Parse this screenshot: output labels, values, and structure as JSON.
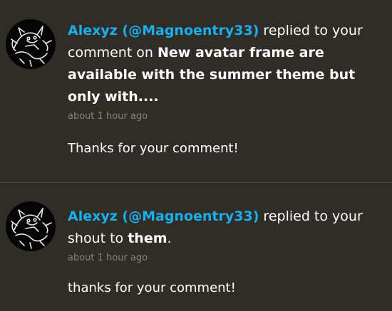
{
  "notifications": [
    {
      "author": "Alexyz (@Magnoentry33)",
      "action": " replied to your comment on ",
      "target": "New avatar frame are available with the summer theme but only with....",
      "suffix": "",
      "time": "about 1 hour ago",
      "message": "Thanks for your comment!",
      "avatar_icon": "cartoon-figure-avatar"
    },
    {
      "author": "Alexyz (@Magnoentry33)",
      "action": " replied to your shout to ",
      "target": "them",
      "suffix": ".",
      "time": "about 1 hour ago",
      "message": "thanks for your comment!",
      "avatar_icon": "cartoon-figure-avatar"
    }
  ],
  "colors": {
    "background": "#302c28",
    "author_link": "#1ab0ee",
    "timestamp": "#8a847d",
    "divider": "#4a4540"
  }
}
